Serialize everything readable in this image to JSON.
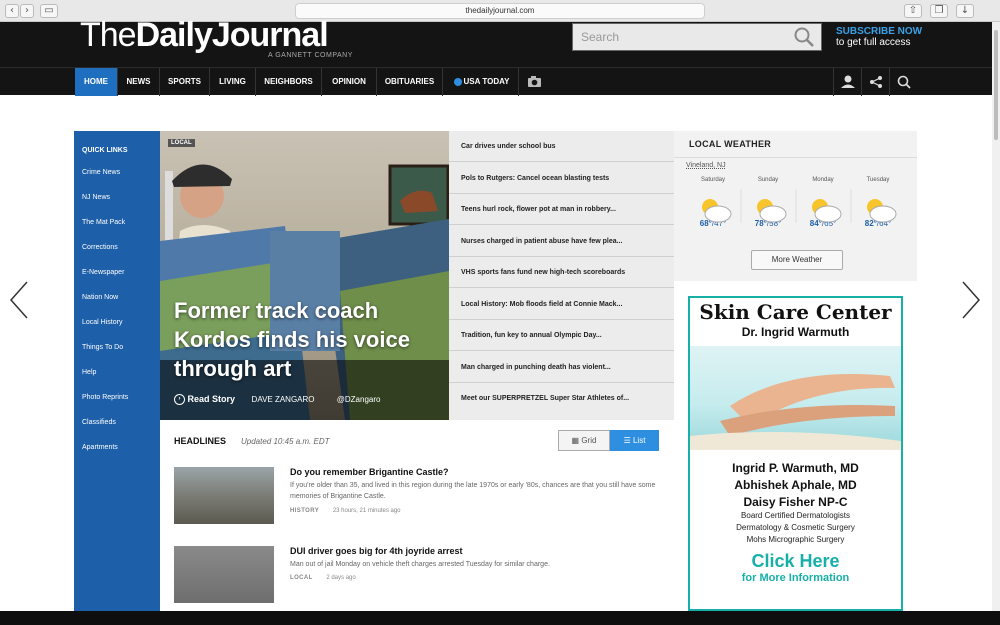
{
  "browser": {
    "url": "thedailyjournal.com"
  },
  "header": {
    "logo_the": "The",
    "logo_name": "DailyJournal",
    "logo_sub": "A GANNETT COMPANY",
    "search_placeholder": "Search",
    "subscribe_line1": "SUBSCRIBE NOW",
    "subscribe_line2": "to get full access"
  },
  "nav": {
    "items": [
      "HOME",
      "NEWS",
      "SPORTS",
      "LIVING",
      "NEIGHBORS",
      "OPINION",
      "OBITUARIES",
      "USA TODAY"
    ]
  },
  "quick_links": {
    "title": "QUICK LINKS",
    "items": [
      "Crime News",
      "NJ News",
      "The Mat Pack",
      "Corrections",
      "E-Newspaper",
      "Nation Now",
      "Local History",
      "Things To Do",
      "Help",
      "Photo Reprints",
      "Classifieds",
      "Apartments"
    ]
  },
  "hero": {
    "tag": "LOCAL",
    "headline": "Former track coach Kordos finds his voice through art",
    "read_story": "Read Story",
    "author": "DAVE ZANGARO",
    "handle": "@DZangaro"
  },
  "stories": [
    "Car drives under school bus",
    "Pols to Rutgers: Cancel ocean blasting tests",
    "Teens hurl rock, flower pot at man in robbery...",
    "Nurses charged in patient abuse have few plea...",
    "VHS sports fans fund new high-tech scoreboards",
    "Local History: Mob floods field at Connie Mack...",
    "Tradition, fun key to annual Olympic Day...",
    "Man charged in punching death has violent...",
    "Meet our SUPERPRETZEL Super Star Athletes of..."
  ],
  "weather": {
    "title": "LOCAL WEATHER",
    "location": "Vineland, NJ",
    "days": [
      {
        "name": "Saturday",
        "high": "68°",
        "low": "/47°"
      },
      {
        "name": "Sunday",
        "high": "78°",
        "low": "/58°"
      },
      {
        "name": "Monday",
        "high": "84°",
        "low": "/65°"
      },
      {
        "name": "Tuesday",
        "high": "82°",
        "low": "/64°"
      }
    ],
    "more_label": "More Weather"
  },
  "ad": {
    "title": "Skin Care Center",
    "doctor": "Dr. Ingrid Warmuth",
    "names": [
      "Ingrid P. Warmuth, MD",
      "Abhishek Aphale, MD",
      "Daisy Fisher NP-C"
    ],
    "desc": [
      "Board Certified Dermatologists",
      "Dermatology & Cosmetic Surgery",
      "Mohs Micrographic Surgery"
    ],
    "cta1": "Click Here",
    "cta2": "for More Information"
  },
  "headlines": {
    "title": "HEADLINES",
    "updated": "Updated 10:45 a.m. EDT",
    "grid_label": "Grid",
    "list_label": "List",
    "articles": [
      {
        "title": "Do you remember Brigantine Castle?",
        "desc": "If you're older than 35, and lived in this region during the late 1970s or early '80s, chances are that you still have some memories of Brigantine Castle.",
        "category": "HISTORY",
        "time": "23 hours, 21 minutes ago"
      },
      {
        "title": "DUI driver goes big for 4th joyride arrest",
        "desc": "Man out of jail Monday on vehicle theft charges arrested Tuesday for similar charge.",
        "category": "LOCAL",
        "time": "2 days ago"
      }
    ]
  },
  "colors": {
    "brand_blue": "#1d5fa8",
    "nav_active": "#1f6fc1",
    "ad_teal": "#17b0a8"
  }
}
